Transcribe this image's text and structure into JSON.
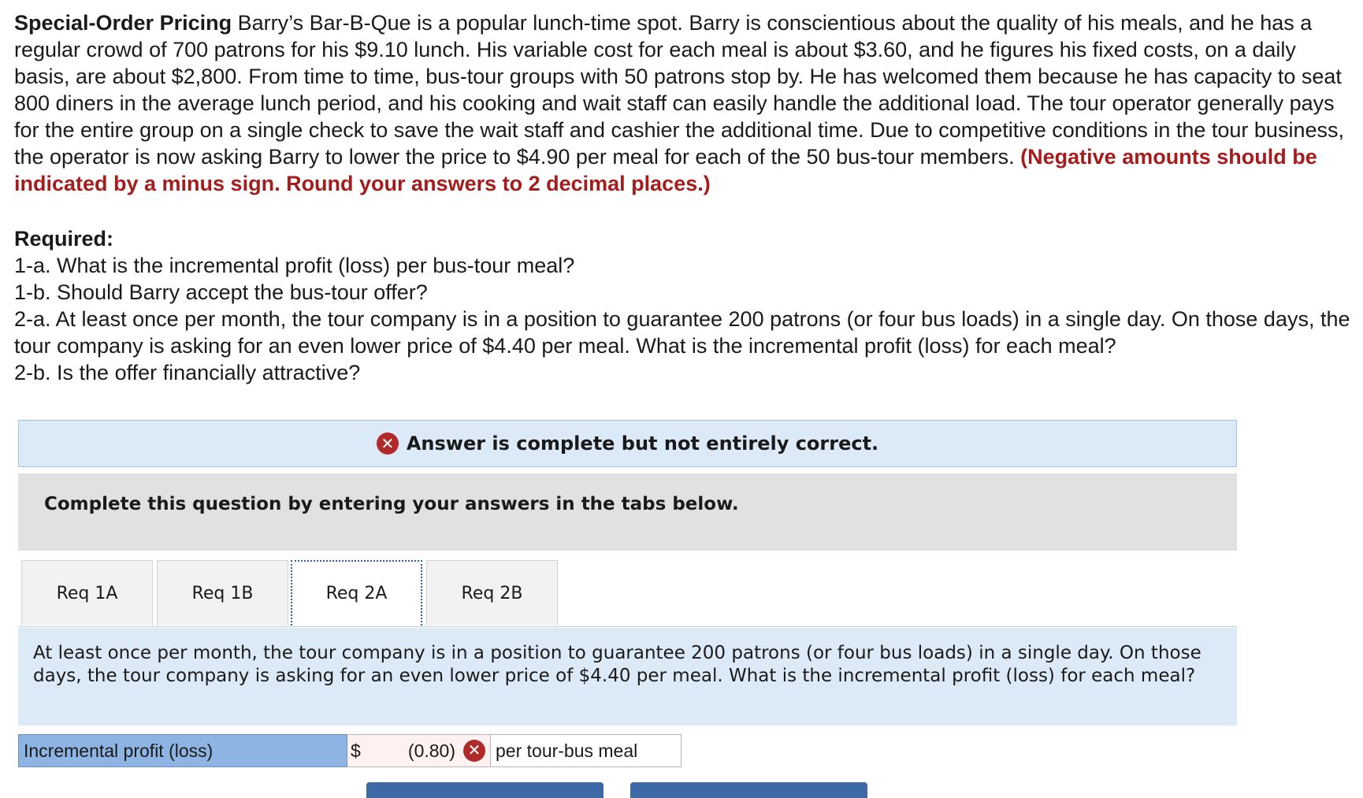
{
  "problem": {
    "title": "Special-Order Pricing",
    "body": " Barry’s Bar-B-Que is a popular lunch-time spot. Barry is conscientious about the quality of his meals, and he has a regular crowd of 700 patrons for his $9.10 lunch. His variable cost for each meal is about $3.60, and he figures his fixed costs, on a daily basis, are about $2,800. From time to time, bus-tour groups with 50 patrons stop by. He has welcomed them because he has capacity to seat 800 diners in the average lunch period, and his cooking and wait staff can easily handle the additional load. The tour operator generally pays for the entire group on a single check to save the wait staff and cashier the additional time. Due to competitive conditions in the tour business, the operator is now asking Barry to lower the price to $4.90 per meal for each of the 50 bus-tour members. ",
    "instruction": "(Negative amounts should be indicated by a minus sign. Round your answers to 2 decimal places.)"
  },
  "required": {
    "title": "Required:",
    "items": [
      "1-a. What is the incremental profit (loss) per bus-tour meal?",
      "1-b. Should Barry accept the bus-tour offer?",
      "2-a. At least once per month, the tour company is in a position to guarantee 200 patrons (or four bus loads) in a single day. On those days, the tour company is asking for an even lower price of $4.40 per meal. What is the incremental profit (loss) for each meal?",
      "2-b. Is the offer financially attractive?"
    ]
  },
  "banner": {
    "text": "Answer is complete but not entirely correct.",
    "icon": "x-circle-icon",
    "status_color": "#b02a2a"
  },
  "instructions": "Complete this question by entering your answers in the tabs below.",
  "tabs": [
    {
      "label": "Req 1A"
    },
    {
      "label": "Req 1B"
    },
    {
      "label": "Req 2A",
      "active": true
    },
    {
      "label": "Req 2B"
    }
  ],
  "question": "At least once per month, the tour company is in a position to guarantee 200 patrons (or four bus loads) in a single day. On those days, the tour company is asking for an even lower price of $4.40 per meal. What is the incremental profit (loss) for each meal?",
  "answer": {
    "label": "Incremental profit (loss)",
    "currency": "$",
    "value": "(0.80)",
    "status": "incorrect",
    "unit": "per tour-bus meal"
  }
}
